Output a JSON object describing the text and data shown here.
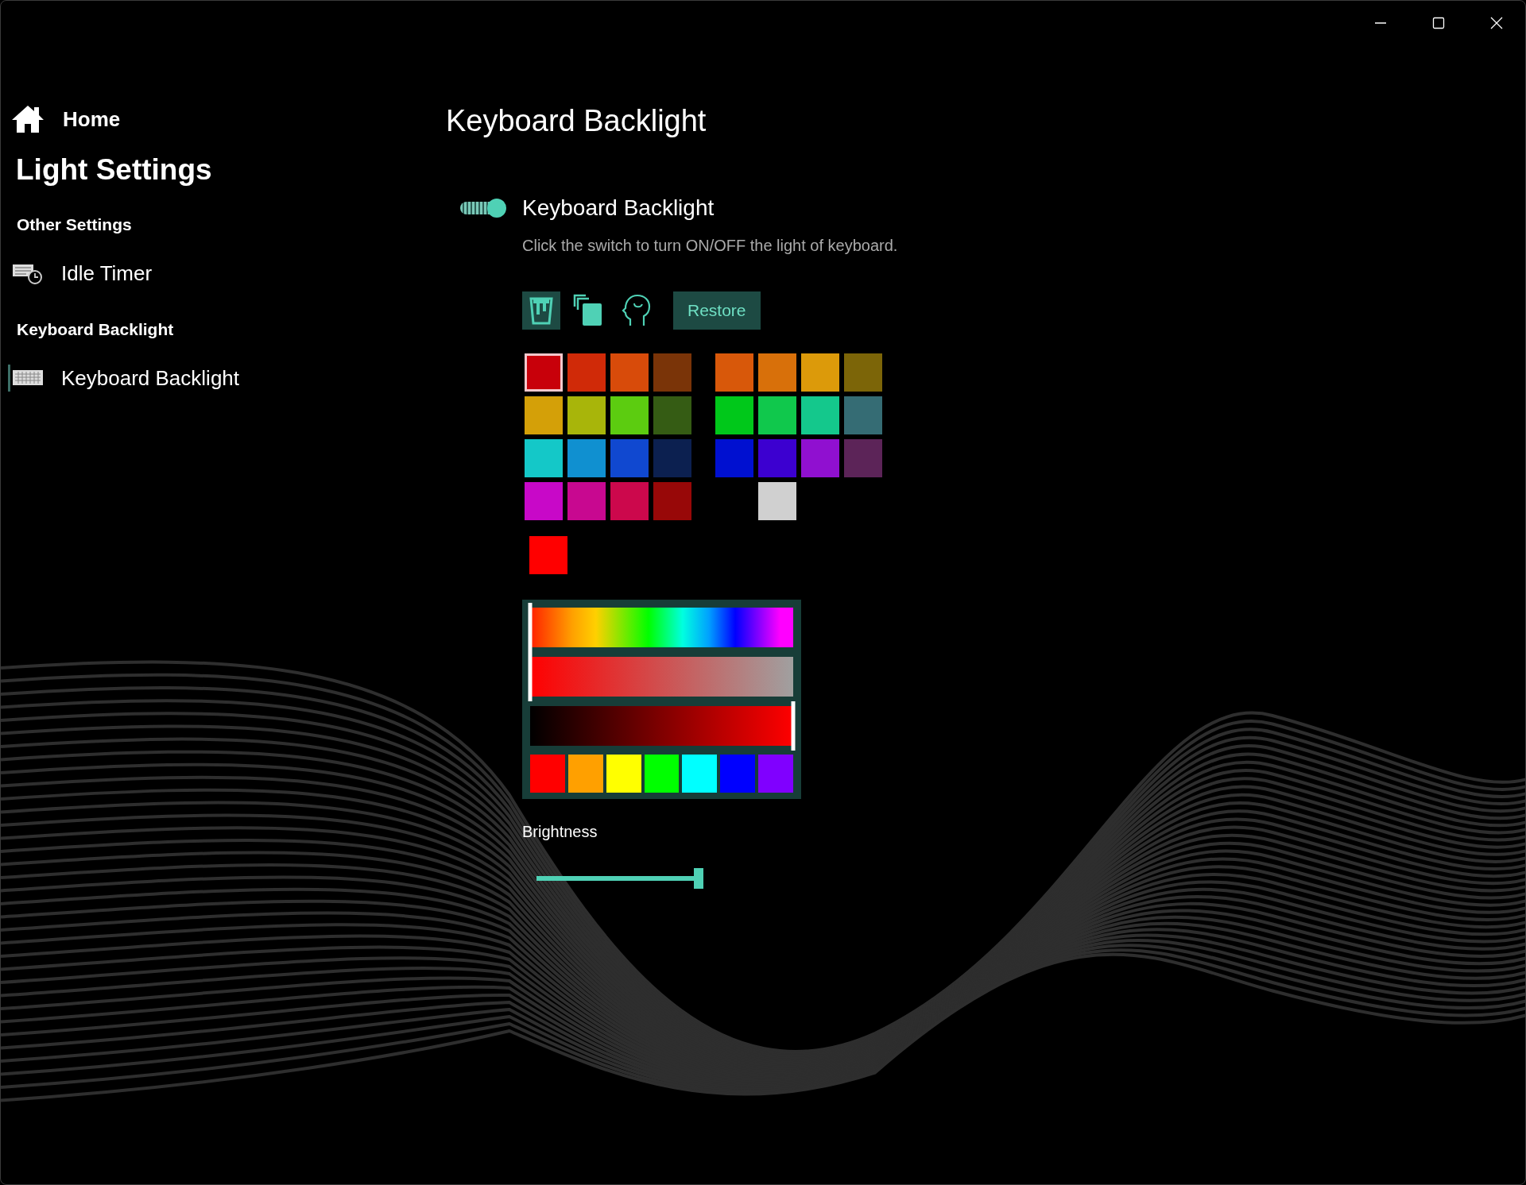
{
  "window": {
    "controls": [
      {
        "kind": "minimize"
      },
      {
        "kind": "maximize"
      },
      {
        "kind": "close"
      }
    ]
  },
  "sidebar": {
    "home": "Home",
    "title": "Light Settings",
    "sections": [
      {
        "header": "Other Settings",
        "items": [
          {
            "label": "Idle Timer",
            "selected": false
          }
        ]
      },
      {
        "header": "Keyboard Backlight",
        "items": [
          {
            "label": "Keyboard Backlight",
            "selected": true
          }
        ]
      }
    ]
  },
  "page": {
    "title": "Keyboard Backlight",
    "toggle": {
      "label": "Keyboard Backlight",
      "on": true,
      "description": "Click the switch to turn ON/OFF the light of keyboard."
    },
    "tools": [
      {
        "kind": "paint",
        "selected": true
      },
      {
        "kind": "copy",
        "selected": false
      },
      {
        "kind": "head",
        "selected": false
      }
    ],
    "restore": "Restore",
    "palette": [
      [
        {
          "kind": "swatch",
          "color": "#c8000a",
          "selected": true
        },
        {
          "kind": "swatch",
          "color": "#d02a08",
          "selected": false
        },
        {
          "kind": "swatch",
          "color": "#d84b0a",
          "selected": false
        },
        {
          "kind": "swatch",
          "color": "#7a3408",
          "selected": false
        },
        {
          "kind": "swatch",
          "color": "#d8580a",
          "selected": false
        },
        {
          "kind": "swatch",
          "color": "#d8700a",
          "selected": false
        },
        {
          "kind": "swatch",
          "color": "#dc9a0a",
          "selected": false
        },
        {
          "kind": "swatch",
          "color": "#7c6508",
          "selected": false
        }
      ],
      [
        {
          "kind": "swatch",
          "color": "#d4a008",
          "selected": false
        },
        {
          "kind": "swatch",
          "color": "#a8b50a",
          "selected": false
        },
        {
          "kind": "swatch",
          "color": "#5ccc10",
          "selected": false
        },
        {
          "kind": "swatch",
          "color": "#355c14",
          "selected": false
        },
        {
          "kind": "swatch",
          "color": "#00c81a",
          "selected": false
        },
        {
          "kind": "swatch",
          "color": "#10c84c",
          "selected": false
        },
        {
          "kind": "swatch",
          "color": "#14c88c",
          "selected": false
        },
        {
          "kind": "swatch",
          "color": "#356c74",
          "selected": false
        }
      ],
      [
        {
          "kind": "swatch",
          "color": "#14c8c8",
          "selected": false
        },
        {
          "kind": "swatch",
          "color": "#1090d0",
          "selected": false
        },
        {
          "kind": "swatch",
          "color": "#1048d0",
          "selected": false
        },
        {
          "kind": "swatch",
          "color": "#0c2050",
          "selected": false
        },
        {
          "kind": "swatch",
          "color": "#0010d0",
          "selected": false
        },
        {
          "kind": "swatch",
          "color": "#3c00d0",
          "selected": false
        },
        {
          "kind": "swatch",
          "color": "#9010d0",
          "selected": false
        },
        {
          "kind": "swatch",
          "color": "#5c2458",
          "selected": false
        }
      ],
      [
        {
          "kind": "swatch",
          "color": "#c808c8",
          "selected": false
        },
        {
          "kind": "swatch",
          "color": "#c80890",
          "selected": false
        },
        {
          "kind": "swatch",
          "color": "#cc084c",
          "selected": false
        },
        {
          "kind": "swatch",
          "color": "#980808",
          "selected": false
        },
        {
          "kind": "blank"
        },
        {
          "kind": "swatch",
          "color": "#d0d0d0",
          "selected": false
        },
        {
          "kind": "blank"
        },
        {
          "kind": "blank"
        }
      ]
    ],
    "current_color": {
      "color": "#ff0000"
    },
    "picker": {
      "hue": {
        "level": 0
      },
      "saturation": {
        "level": 0
      },
      "value": {
        "level": 1
      },
      "presets": [
        {
          "color": "#ff0000"
        },
        {
          "color": "#ffa000"
        },
        {
          "color": "#ffff00"
        },
        {
          "color": "#00ff00"
        },
        {
          "color": "#00ffff"
        },
        {
          "color": "#0000ff"
        },
        {
          "color": "#8000ff"
        }
      ]
    },
    "brightness": {
      "label": "Brightness",
      "level": 1
    }
  }
}
